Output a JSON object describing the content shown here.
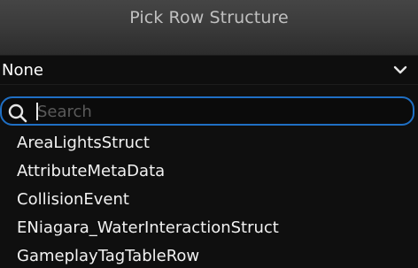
{
  "dialog": {
    "title": "Pick Row Structure"
  },
  "combo": {
    "value": "None",
    "chevron_icon": "chevron-down-icon"
  },
  "search": {
    "placeholder": "Search",
    "value": "",
    "icon": "search-icon",
    "focus_color": "#1f6fc4"
  },
  "list": {
    "items": [
      {
        "label": "AreaLightsStruct"
      },
      {
        "label": "AttributeMetaData"
      },
      {
        "label": "CollisionEvent"
      },
      {
        "label": "ENiagara_WaterInteractionStruct"
      },
      {
        "label": "GameplayTagTableRow"
      }
    ]
  }
}
